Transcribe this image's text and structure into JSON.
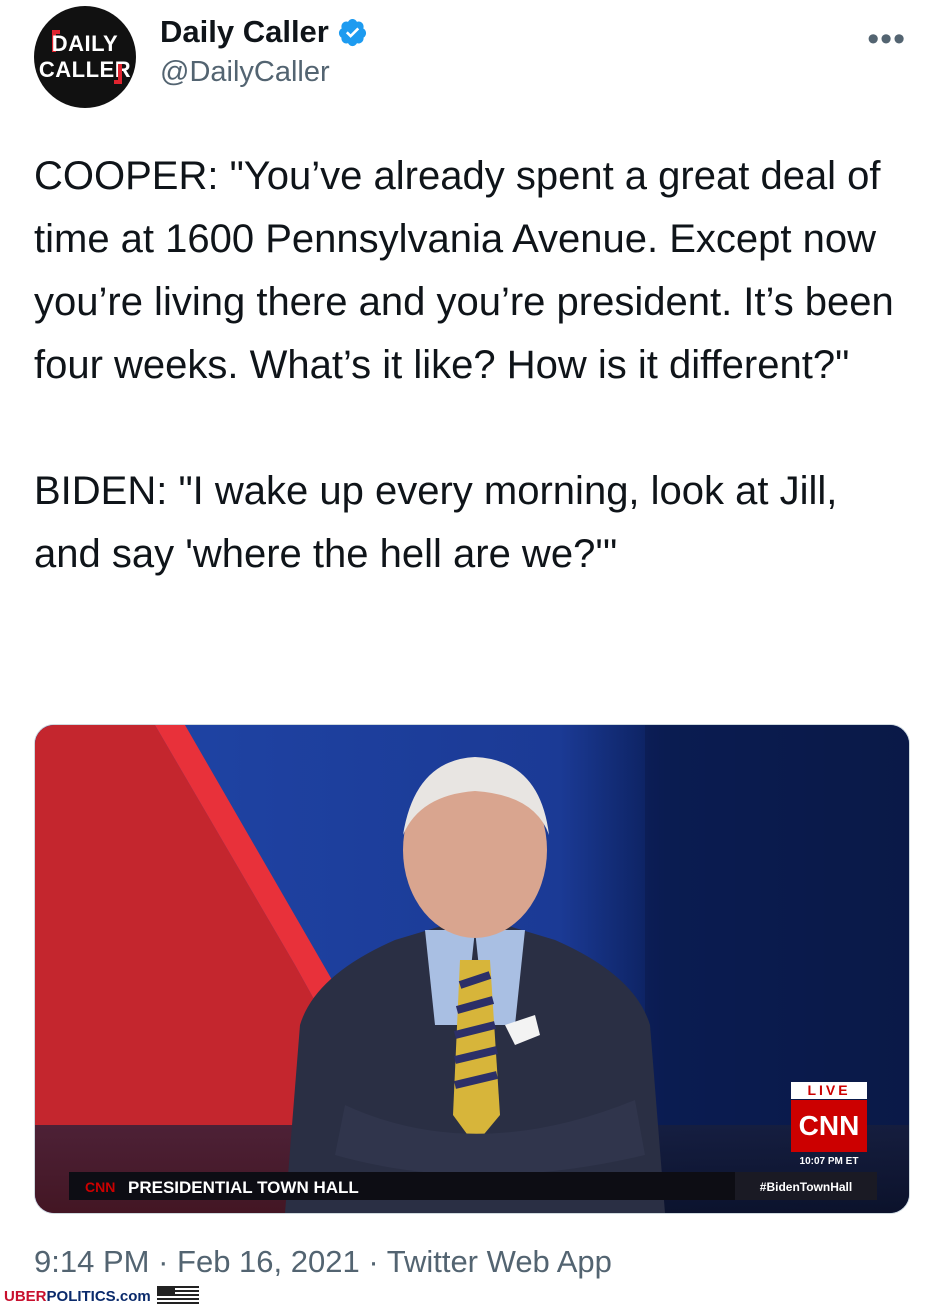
{
  "account": {
    "avatar_line1": "DAILY",
    "avatar_line2": "CALLER",
    "name": "Daily Caller",
    "handle": "@DailyCaller",
    "more_icon": "more-horizontal-icon"
  },
  "tweet": {
    "text": "COOPER: \"You’ve already spent a great deal of time at 1600 Pennsylvania Avenue. Except now you’re living there and you’re president. It’s been four weeks. What’s it like? How is it different?\"\n\nBIDEN: \"I wake up every morning, look at Jill, and say 'where the hell are we?'\""
  },
  "media": {
    "live_label": "LIVE",
    "network_logo": "CNN",
    "time_label": "10:07 PM ET",
    "lower_third_logo": "CNN",
    "lower_third_title": "PRESIDENTIAL TOWN HALL",
    "hashtag": "#BidenTownHall"
  },
  "meta": {
    "time": "9:14 PM",
    "date": "Feb 16, 2021",
    "separator": " · ",
    "source": "Twitter Web App"
  },
  "watermark": {
    "part1": "UBER",
    "part2": "POLITICS.com"
  },
  "colors": {
    "verified": "#1d9bf0",
    "secondary_text": "#536471",
    "brand_red": "#c8102e"
  }
}
